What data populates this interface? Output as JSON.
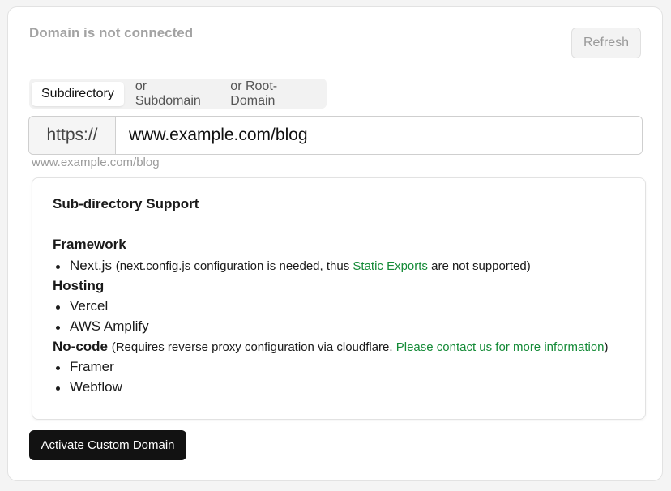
{
  "header": {
    "status": "Domain is not connected",
    "refresh_label": "Refresh"
  },
  "tabs": [
    {
      "label": "Subdirectory",
      "active": true
    },
    {
      "label": "or Subdomain",
      "active": false
    },
    {
      "label": "or Root-Domain",
      "active": false
    }
  ],
  "url": {
    "prefix": "https://",
    "value": "www.example.com/blog",
    "hint": "www.example.com/blog"
  },
  "support": {
    "title": "Sub-directory Support",
    "framework": {
      "heading": "Framework",
      "items": [
        {
          "name": "Next.js",
          "note_before": "(next.config.js configuration is needed, thus ",
          "link": "Static Exports",
          "note_after": " are not supported)"
        }
      ]
    },
    "hosting": {
      "heading": "Hosting",
      "items": [
        "Vercel",
        "AWS Amplify"
      ]
    },
    "nocode": {
      "heading": "No-code",
      "note_before": "(Requires reverse proxy configuration via cloudflare. ",
      "link": "Please contact us for more information",
      "note_after": ")",
      "items": [
        "Framer",
        "Webflow"
      ]
    }
  },
  "actions": {
    "activate_label": "Activate Custom Domain"
  },
  "colors": {
    "link": "#138a36",
    "primary_button": "#121212",
    "muted_text": "#a3a3a3"
  }
}
